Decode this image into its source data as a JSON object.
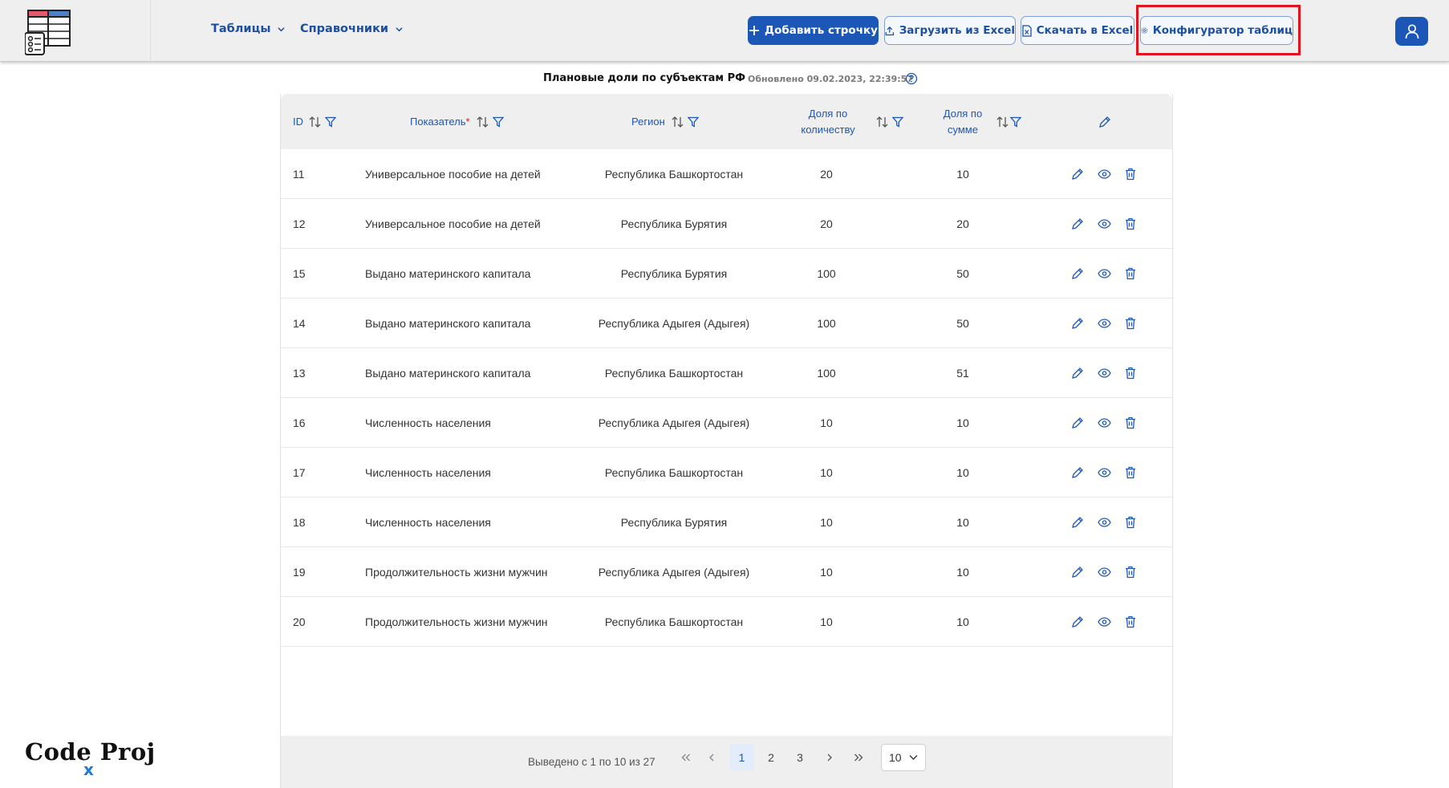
{
  "header": {
    "nav": [
      {
        "label": "Таблицы"
      },
      {
        "label": "Справочники"
      }
    ],
    "buttons": {
      "add_row": "Добавить строчку",
      "upload_excel": "Загрузить из Excel",
      "download_excel": "Скачать в Excel",
      "configurator": "Конфигуратор таблиц"
    }
  },
  "page": {
    "title": "Плановые доли по субъектам РФ",
    "updated": "Обновлено 09.02.2023, 22:39:57"
  },
  "table": {
    "columns": {
      "id": "ID",
      "indicator": "Показатель",
      "indicator_required": "*",
      "region": "Регион",
      "qty_line1": "Доля по",
      "qty_line2": "количеству",
      "sum_line1": "Доля по",
      "sum_line2": "сумме"
    },
    "rows": [
      {
        "id": "11",
        "indicator": "Универсальное пособие на детей",
        "region": "Республика Башкортостан",
        "qty": "20",
        "sum": "10"
      },
      {
        "id": "12",
        "indicator": "Универсальное пособие на детей",
        "region": "Республика Бурятия",
        "qty": "20",
        "sum": "20"
      },
      {
        "id": "15",
        "indicator": "Выдано материнского капитала",
        "region": "Республика Бурятия",
        "qty": "100",
        "sum": "50"
      },
      {
        "id": "14",
        "indicator": "Выдано материнского капитала",
        "region": "Республика Адыгея (Адыгея)",
        "qty": "100",
        "sum": "50"
      },
      {
        "id": "13",
        "indicator": "Выдано материнского капитала",
        "region": "Республика Башкортостан",
        "qty": "100",
        "sum": "51"
      },
      {
        "id": "16",
        "indicator": "Численность населения",
        "region": "Республика Адыгея (Адыгея)",
        "qty": "10",
        "sum": "10"
      },
      {
        "id": "17",
        "indicator": "Численность населения",
        "region": "Республика Башкортостан",
        "qty": "10",
        "sum": "10"
      },
      {
        "id": "18",
        "indicator": "Численность населения",
        "region": "Республика Бурятия",
        "qty": "10",
        "sum": "10"
      },
      {
        "id": "19",
        "indicator": "Продолжительность жизни мужчин",
        "region": "Республика Адыгея (Адыгея)",
        "qty": "10",
        "sum": "10"
      },
      {
        "id": "20",
        "indicator": "Продолжительность жизни мужчин",
        "region": "Республика Башкортостан",
        "qty": "10",
        "sum": "10"
      }
    ]
  },
  "pagination": {
    "summary": "Выведено с 1 по 10 из 27",
    "pages": [
      "1",
      "2",
      "3"
    ],
    "current": "1",
    "page_size": "10"
  },
  "watermark": {
    "text": "Code Proj",
    "x": "x"
  },
  "colors": {
    "accent": "#1c57b8",
    "header_bg": "#efefef",
    "highlight": "#e0141e"
  }
}
